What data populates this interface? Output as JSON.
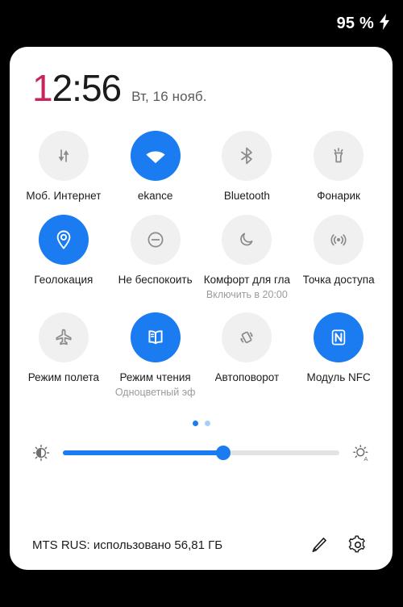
{
  "status_bar": {
    "battery_text": "95 %",
    "charging_icon": "lightning-bolt-icon"
  },
  "header": {
    "time_first_char": "1",
    "time_rest": "2:56",
    "time_full": "12:56",
    "date": "Вт, 16 нояб."
  },
  "colors": {
    "accent_blue": "#1a7cf0",
    "tile_off_bg": "#f0f0f0",
    "clock_accent": "#c9255c",
    "panel_bg": "#ffffff",
    "screen_bg": "#000000",
    "dot_inactive": "#a8cdf6"
  },
  "tiles": [
    [
      {
        "label": "Моб. Интернет",
        "sub": "",
        "icon": "mobile-data-icon",
        "active": false
      },
      {
        "label": "ekance",
        "sub": "",
        "icon": "wifi-icon",
        "active": true
      },
      {
        "label": "Bluetooth",
        "sub": "",
        "icon": "bluetooth-icon",
        "active": false
      },
      {
        "label": "Фонарик",
        "sub": "",
        "icon": "flashlight-icon",
        "active": false
      }
    ],
    [
      {
        "label": "Геолокация",
        "sub": "",
        "icon": "location-pin-icon",
        "active": true
      },
      {
        "label": "Не беспокоить",
        "sub": "",
        "icon": "do-not-disturb-icon",
        "active": false
      },
      {
        "label": "Комфорт для гла",
        "sub": "Включить в 20:00",
        "icon": "moon-icon",
        "active": false
      },
      {
        "label": "Точка доступа",
        "sub": "",
        "icon": "hotspot-icon",
        "active": false
      }
    ],
    [
      {
        "label": "Режим полета",
        "sub": "",
        "icon": "airplane-icon",
        "active": false
      },
      {
        "label": "Режим чтения",
        "sub": "Одноцветный эф",
        "icon": "book-icon",
        "active": true
      },
      {
        "label": "Автоповорот",
        "sub": "",
        "icon": "auto-rotate-icon",
        "active": false
      },
      {
        "label": "Модуль NFC",
        "sub": "",
        "icon": "nfc-icon",
        "active": true
      }
    ]
  ],
  "pager": {
    "total": 2,
    "active_index": 0
  },
  "brightness": {
    "value_percent": 58,
    "low_icon": "brightness-low-icon",
    "auto_icon": "brightness-auto-icon"
  },
  "footer": {
    "carrier_text": "MTS RUS: использовано 56,81 ГБ",
    "edit_icon": "pencil-icon",
    "settings_icon": "gear-icon"
  }
}
